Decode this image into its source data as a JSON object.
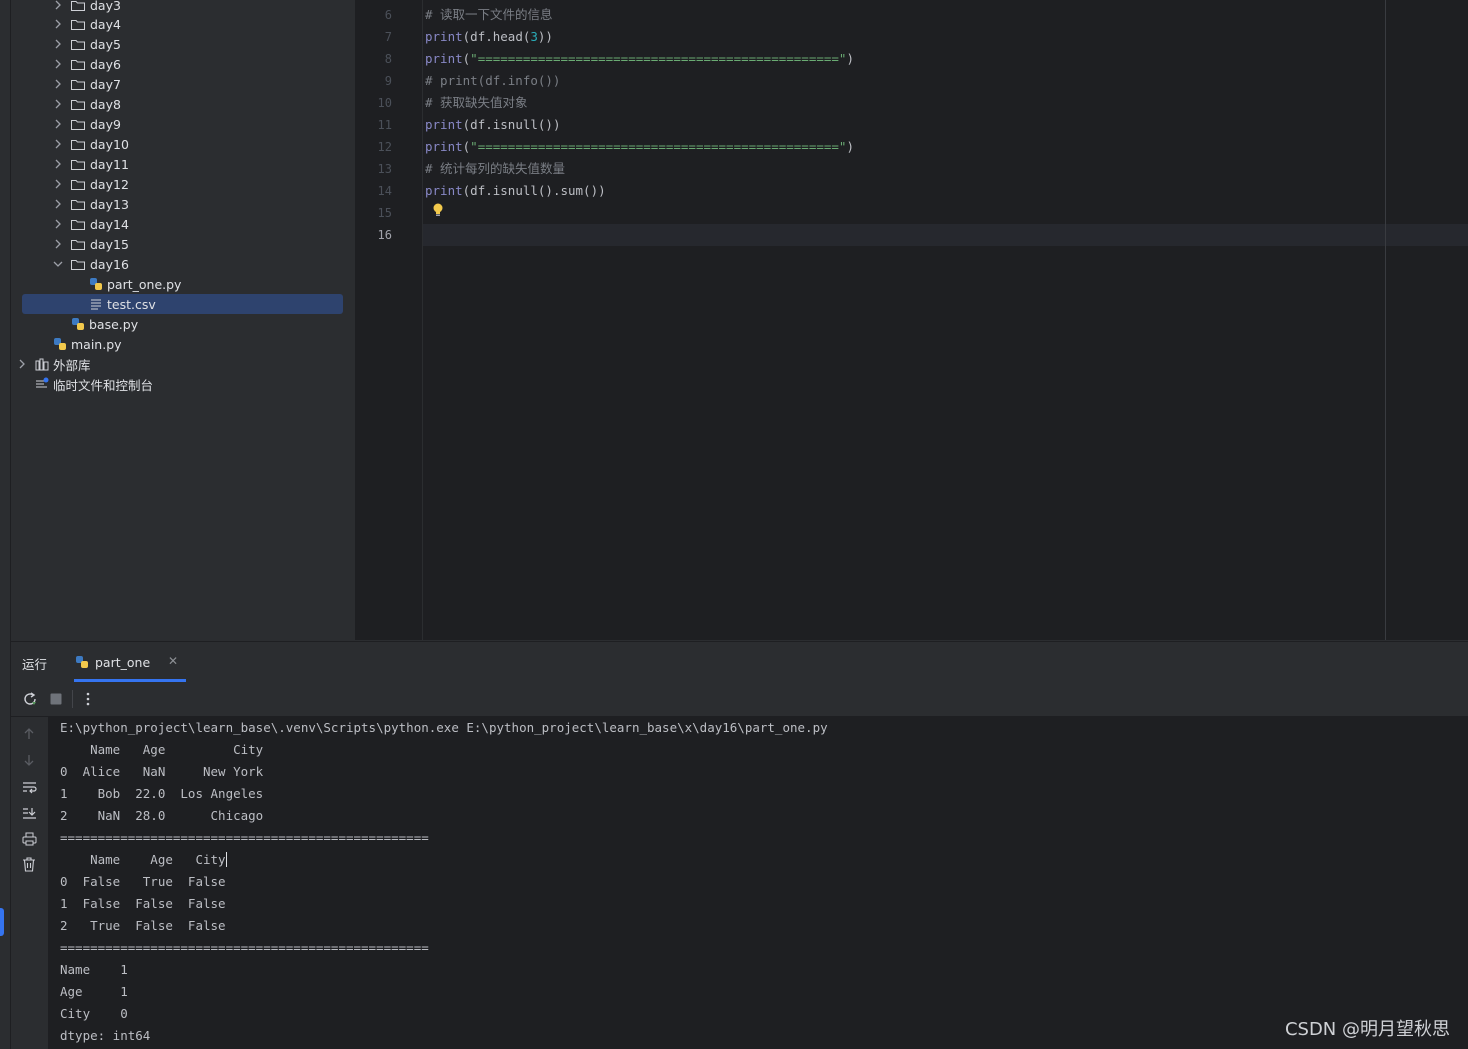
{
  "project_tree": {
    "items": [
      {
        "label": "day3",
        "kind": "folder",
        "expanded": false
      },
      {
        "label": "day4",
        "kind": "folder",
        "expanded": false
      },
      {
        "label": "day5",
        "kind": "folder",
        "expanded": false
      },
      {
        "label": "day6",
        "kind": "folder",
        "expanded": false
      },
      {
        "label": "day7",
        "kind": "folder",
        "expanded": false
      },
      {
        "label": "day8",
        "kind": "folder",
        "expanded": false
      },
      {
        "label": "day9",
        "kind": "folder",
        "expanded": false
      },
      {
        "label": "day10",
        "kind": "folder",
        "expanded": false
      },
      {
        "label": "day11",
        "kind": "folder",
        "expanded": false
      },
      {
        "label": "day12",
        "kind": "folder",
        "expanded": false
      },
      {
        "label": "day13",
        "kind": "folder",
        "expanded": false
      },
      {
        "label": "day14",
        "kind": "folder",
        "expanded": false
      },
      {
        "label": "day15",
        "kind": "folder",
        "expanded": false
      },
      {
        "label": "day16",
        "kind": "folder",
        "expanded": true
      },
      {
        "label": "part_one.py",
        "kind": "python-file"
      },
      {
        "label": "test.csv",
        "kind": "text-file",
        "selected": true
      },
      {
        "label": "base.py",
        "kind": "python-file"
      },
      {
        "label": "main.py",
        "kind": "python-file"
      },
      {
        "label": "外部库",
        "kind": "library"
      },
      {
        "label": "临时文件和控制台",
        "kind": "scratches"
      }
    ]
  },
  "editor": {
    "current_line": "16",
    "line_numbers": [
      "6",
      "7",
      "8",
      "9",
      "10",
      "11",
      "12",
      "13",
      "14",
      "15",
      "16"
    ],
    "lines": [
      {
        "comment": "# 读取一下文件的信息"
      },
      {
        "kw": "print",
        "p1": "(df.head(",
        "num": "3",
        "p2": "))"
      },
      {
        "kw": "print",
        "p1": "(",
        "str": "\"================================================\"",
        "p2": ")"
      },
      {
        "comment": "# print(df.info())"
      },
      {
        "comment": "# 获取缺失值对象"
      },
      {
        "kw": "print",
        "p1": "(df.isnull())"
      },
      {
        "kw": "print",
        "p1": "(",
        "str": "\"================================================\"",
        "p2": ")"
      },
      {
        "comment": "# 统计每列的缺失值数量"
      },
      {
        "kw": "print",
        "p1": "(df.isnull().sum())"
      }
    ]
  },
  "run_panel": {
    "title": "运行",
    "tab_label": "part_one",
    "icons": [
      "rerun-icon",
      "stop-icon",
      "more-icon",
      "up-arrow-icon",
      "down-arrow-icon",
      "soft-wrap-icon",
      "scroll-to-end-icon",
      "print-icon",
      "trash-icon"
    ]
  },
  "console": {
    "lines": [
      "E:\\python_project\\learn_base\\.venv\\Scripts\\python.exe E:\\python_project\\learn_base\\x\\day16\\part_one.py",
      "    Name   Age         City",
      "0  Alice   NaN     New York",
      "1    Bob  22.0  Los Angeles",
      "2    NaN  28.0      Chicago",
      "=================================================",
      "    Name    Age   City",
      "0  False   True  False",
      "1  False  False  False",
      "2   True  False  False",
      "=================================================",
      "Name    1",
      "Age     1",
      "City    0",
      "dtype: int64"
    ]
  },
  "watermark": "CSDN @明月望秋思",
  "colors": {
    "accent": "#3574f0",
    "selection": "#2e436e",
    "editor_bg": "#1e1f22",
    "panel_bg": "#2b2d30"
  }
}
